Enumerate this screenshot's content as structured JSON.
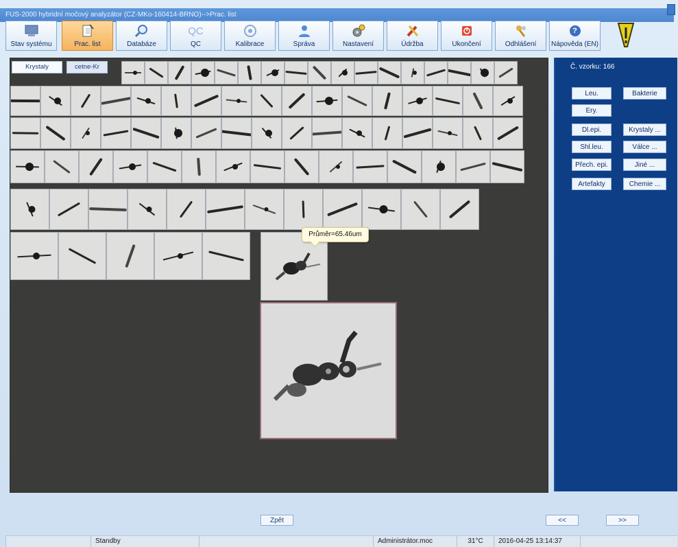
{
  "window": {
    "title": "FUS-2000 hybridní močový analyzátor (CZ-MKo-160414-BRNO)-->Prac. list"
  },
  "toolbar": {
    "items": [
      {
        "label": "Stav systému",
        "icon": "monitor-icon"
      },
      {
        "label": "Prac. list",
        "icon": "worklist-icon"
      },
      {
        "label": "Databáze",
        "icon": "magnifier-icon"
      },
      {
        "label": "QC",
        "icon": "qc-icon"
      },
      {
        "label": "Kalibrace",
        "icon": "target-icon"
      },
      {
        "label": "Správa",
        "icon": "user-icon"
      },
      {
        "label": "Nastavení",
        "icon": "gears-icon"
      },
      {
        "label": "Údržba",
        "icon": "tools-icon"
      },
      {
        "label": "Ukončení",
        "icon": "power-icon"
      },
      {
        "label": "Odhlášení",
        "icon": "keys-icon"
      },
      {
        "label": "Nápověda (EN)",
        "icon": "help-icon"
      }
    ],
    "qc_icon_text": "QC",
    "help_icon_text": "?"
  },
  "workspace": {
    "tabs": [
      {
        "label": "Krystaly"
      },
      {
        "label": "cetne-Kr"
      }
    ],
    "tooltip": "Průměr=65.46um"
  },
  "right_panel": {
    "sample_label": "Č. vzorku: 166",
    "buttons": [
      {
        "label": "Leu."
      },
      {
        "label": "Bakterie"
      },
      {
        "label": "Ery."
      },
      {
        "label": "Dl.epi."
      },
      {
        "label": "Krystaly ..."
      },
      {
        "label": "Shl.leu."
      },
      {
        "label": "Válce ..."
      },
      {
        "label": "Přech. epi."
      },
      {
        "label": "Jiné ..."
      },
      {
        "label": "Artefakty"
      },
      {
        "label": "Chemie ..."
      }
    ]
  },
  "bottom": {
    "back_label": "Zpět",
    "prev_label": "<<",
    "next_label": ">>"
  },
  "status": {
    "state": "Standby",
    "user": "Administrátor.moc",
    "temperature": "31°C",
    "datetime": "2016-04-25 13:14:37"
  },
  "colors": {
    "accent": "#f5b35d",
    "panel": "#0e3e86",
    "workspace": "#3b3c39"
  }
}
